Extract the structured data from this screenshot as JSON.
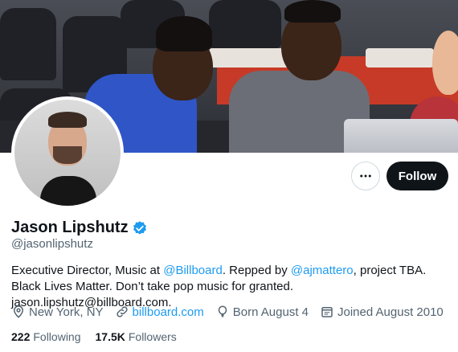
{
  "profile": {
    "name": "Jason Lipshutz",
    "handle": "@jasonlipshutz",
    "verified": true,
    "bio": {
      "part1": "Executive Director, Music at ",
      "mention1": "@Billboard",
      "part2": ". Repped by ",
      "mention2": "@ajmattero",
      "part3": ", project TBA. Black Lives Matter. Don’t take pop music for granted. jason.lipshutz@billboard.com."
    },
    "location": "New York, NY",
    "website": "billboard.com",
    "birthday": "Born August 4",
    "joined": "Joined August 2010",
    "following_count": "222",
    "following_label": "Following",
    "followers_count": "17.5K",
    "followers_label": "Followers"
  },
  "actions": {
    "follow_label": "Follow",
    "more_icon": "more-horizontal-icon"
  },
  "colors": {
    "link": "#1d9bf0",
    "follow_bg": "#0f1419",
    "muted": "#536471",
    "verified": "#1d9bf0"
  }
}
